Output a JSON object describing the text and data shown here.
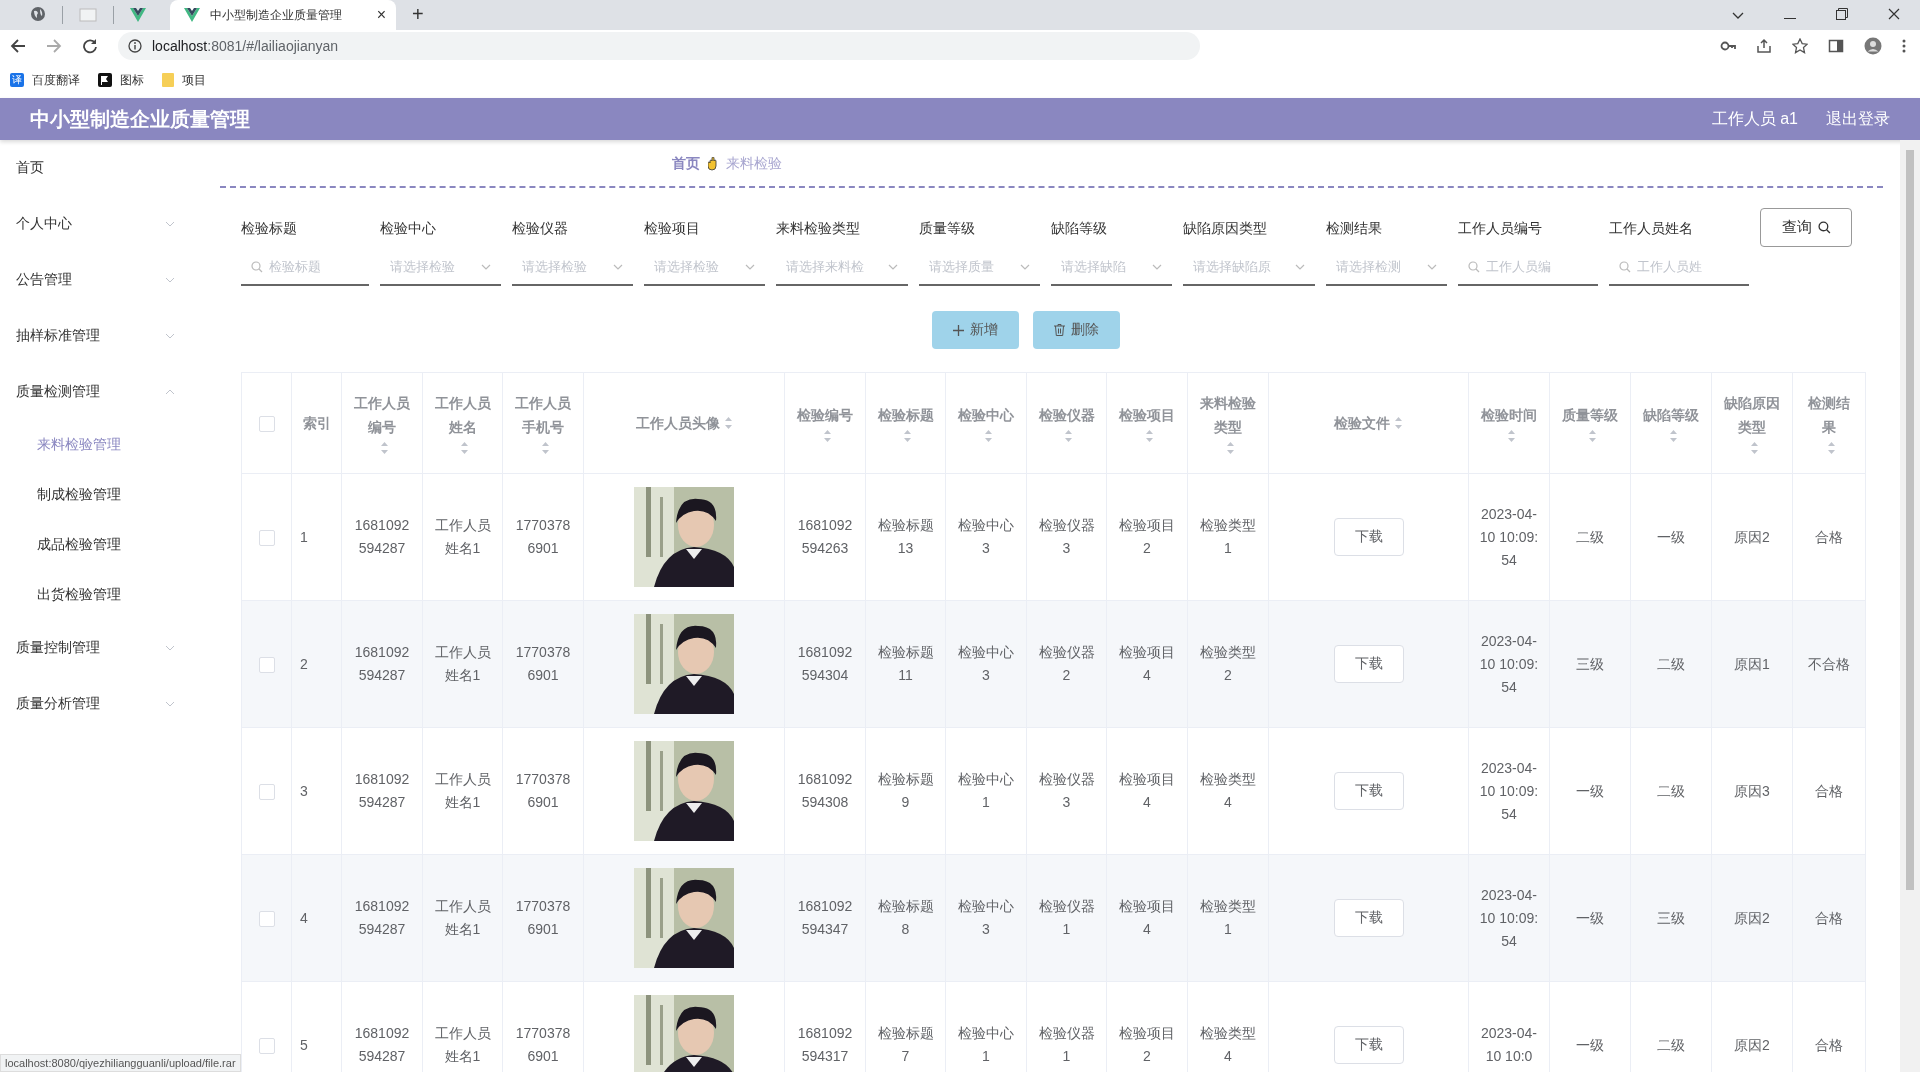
{
  "browser": {
    "tab_title": "中小型制造企业质量管理",
    "tab_close": "×",
    "new_tab": "+",
    "url_host": "localhost",
    "url_rest": ":8081/#/lailiaojianyan",
    "bookmarks": [
      {
        "label": "百度翻译",
        "kind": "translate",
        "glyph": "译"
      },
      {
        "label": "图标",
        "kind": "flag"
      },
      {
        "label": "项目",
        "kind": "folder"
      }
    ],
    "status_url": "localhost:8080/qiyezhiliangguanli/upload/file.rar"
  },
  "header": {
    "title": "中小型制造企业质量管理",
    "user": "工作人员 a1",
    "logout": "退出登录"
  },
  "sidebar": {
    "items": [
      {
        "label": "首页"
      },
      {
        "label": "个人中心",
        "expanded": false
      },
      {
        "label": "公告管理",
        "expanded": false
      },
      {
        "label": "抽样标准管理",
        "expanded": false
      },
      {
        "label": "质量检测管理",
        "expanded": true,
        "children": [
          {
            "label": "来料检验管理",
            "selected": true
          },
          {
            "label": "制成检验管理",
            "selected": false
          },
          {
            "label": "成品检验管理",
            "selected": false
          },
          {
            "label": "出货检验管理",
            "selected": false
          }
        ]
      },
      {
        "label": "质量控制管理",
        "expanded": false
      },
      {
        "label": "质量分析管理",
        "expanded": false
      }
    ]
  },
  "breadcrumb": {
    "home": "首页",
    "current": "来料检验"
  },
  "filters": [
    {
      "label": "检验标题",
      "kind": "text",
      "placeholder": "检验标题"
    },
    {
      "label": "检验中心",
      "kind": "select",
      "placeholder": "请选择检验"
    },
    {
      "label": "检验仪器",
      "kind": "select",
      "placeholder": "请选择检验"
    },
    {
      "label": "检验项目",
      "kind": "select",
      "placeholder": "请选择检验"
    },
    {
      "label": "来料检验类型",
      "kind": "select",
      "placeholder": "请选择来料检"
    },
    {
      "label": "质量等级",
      "kind": "select",
      "placeholder": "请选择质量"
    },
    {
      "label": "缺陷等级",
      "kind": "select",
      "placeholder": "请选择缺陷"
    },
    {
      "label": "缺陷原因类型",
      "kind": "select",
      "placeholder": "请选择缺陷原"
    },
    {
      "label": "检测结果",
      "kind": "select",
      "placeholder": "请选择检测"
    },
    {
      "label": "工作人员编号",
      "kind": "text",
      "placeholder": "工作人员编"
    },
    {
      "label": "工作人员姓名",
      "kind": "text",
      "placeholder": "工作人员姓"
    }
  ],
  "query_button": "查询",
  "actions": [
    {
      "label": "新增",
      "kind": "add"
    },
    {
      "label": "删除",
      "kind": "delete"
    }
  ],
  "table": {
    "all_checked": false,
    "columns": [
      {
        "label": "索引",
        "sortable": false
      },
      {
        "label": "工作人员编号",
        "sortable": true
      },
      {
        "label": "工作人员姓名",
        "sortable": true
      },
      {
        "label": "工作人员手机号",
        "sortable": true
      },
      {
        "label": "工作人员头像",
        "sortable": true
      },
      {
        "label": "检验编号",
        "sortable": true
      },
      {
        "label": "检验标题",
        "sortable": true
      },
      {
        "label": "检验中心",
        "sortable": true
      },
      {
        "label": "检验仪器",
        "sortable": true
      },
      {
        "label": "检验项目",
        "sortable": true
      },
      {
        "label": "来料检验类型",
        "sortable": true
      },
      {
        "label": "检验文件",
        "sortable": true
      },
      {
        "label": "检验时间",
        "sortable": true
      },
      {
        "label": "质量等级",
        "sortable": true
      },
      {
        "label": "缺陷等级",
        "sortable": true
      },
      {
        "label": "缺陷原因类型",
        "sortable": true
      },
      {
        "label": "检测结果",
        "sortable": true
      }
    ],
    "rows": [
      {
        "checked": false,
        "cells": [
          {
            "text": "1"
          },
          {
            "text": "1681092594287"
          },
          {
            "text": "工作人员姓名1"
          },
          {
            "text": "17703786901"
          },
          {
            "kind": "picture"
          },
          {
            "text": "1681092594263"
          },
          {
            "text": "检验标题13"
          },
          {
            "text": "检验中心3"
          },
          {
            "text": "检验仪器3"
          },
          {
            "text": "检验项目2"
          },
          {
            "text": "检验类型1"
          },
          {
            "kind": "button",
            "text": "下载"
          },
          {
            "text": "2023-04-10 10:09:54"
          },
          {
            "text": "二级"
          },
          {
            "text": "一级"
          },
          {
            "text": "原因2"
          },
          {
            "text": "合格"
          }
        ]
      },
      {
        "checked": false,
        "cells": [
          {
            "text": "2"
          },
          {
            "text": "1681092594287"
          },
          {
            "text": "工作人员姓名1"
          },
          {
            "text": "17703786901"
          },
          {
            "kind": "picture"
          },
          {
            "text": "1681092594304"
          },
          {
            "text": "检验标题11"
          },
          {
            "text": "检验中心3"
          },
          {
            "text": "检验仪器2"
          },
          {
            "text": "检验项目4"
          },
          {
            "text": "检验类型2"
          },
          {
            "kind": "button",
            "text": "下载"
          },
          {
            "text": "2023-04-10 10:09:54"
          },
          {
            "text": "三级"
          },
          {
            "text": "二级"
          },
          {
            "text": "原因1"
          },
          {
            "text": "不合格"
          }
        ]
      },
      {
        "checked": false,
        "cells": [
          {
            "text": "3"
          },
          {
            "text": "1681092594287"
          },
          {
            "text": "工作人员姓名1"
          },
          {
            "text": "17703786901"
          },
          {
            "kind": "picture"
          },
          {
            "text": "1681092594308"
          },
          {
            "text": "检验标题9"
          },
          {
            "text": "检验中心1"
          },
          {
            "text": "检验仪器3"
          },
          {
            "text": "检验项目4"
          },
          {
            "text": "检验类型4"
          },
          {
            "kind": "button",
            "text": "下载"
          },
          {
            "text": "2023-04-10 10:09:54"
          },
          {
            "text": "一级"
          },
          {
            "text": "二级"
          },
          {
            "text": "原因3"
          },
          {
            "text": "合格"
          }
        ]
      },
      {
        "checked": false,
        "cells": [
          {
            "text": "4"
          },
          {
            "text": "1681092594287"
          },
          {
            "text": "工作人员姓名1"
          },
          {
            "text": "17703786901"
          },
          {
            "kind": "picture"
          },
          {
            "text": "1681092594347"
          },
          {
            "text": "检验标题8"
          },
          {
            "text": "检验中心3"
          },
          {
            "text": "检验仪器1"
          },
          {
            "text": "检验项目4"
          },
          {
            "text": "检验类型1"
          },
          {
            "kind": "button",
            "text": "下载"
          },
          {
            "text": "2023-04-10 10:09:54"
          },
          {
            "text": "一级"
          },
          {
            "text": "三级"
          },
          {
            "text": "原因2"
          },
          {
            "text": "合格"
          }
        ]
      },
      {
        "checked": false,
        "cells": [
          {
            "text": "5"
          },
          {
            "text": "1681092594287"
          },
          {
            "text": "工作人员姓名1"
          },
          {
            "text": "17703786901"
          },
          {
            "kind": "picture"
          },
          {
            "text": "1681092594317"
          },
          {
            "text": "检验标题7"
          },
          {
            "text": "检验中心1"
          },
          {
            "text": "检验仪器1"
          },
          {
            "text": "检验项目2"
          },
          {
            "text": "检验类型4"
          },
          {
            "kind": "button",
            "text": "下载"
          },
          {
            "text": "2023-04-10 10:0"
          },
          {
            "text": "一级"
          },
          {
            "text": "二级"
          },
          {
            "text": "原因2"
          },
          {
            "text": "合格"
          }
        ]
      }
    ]
  }
}
